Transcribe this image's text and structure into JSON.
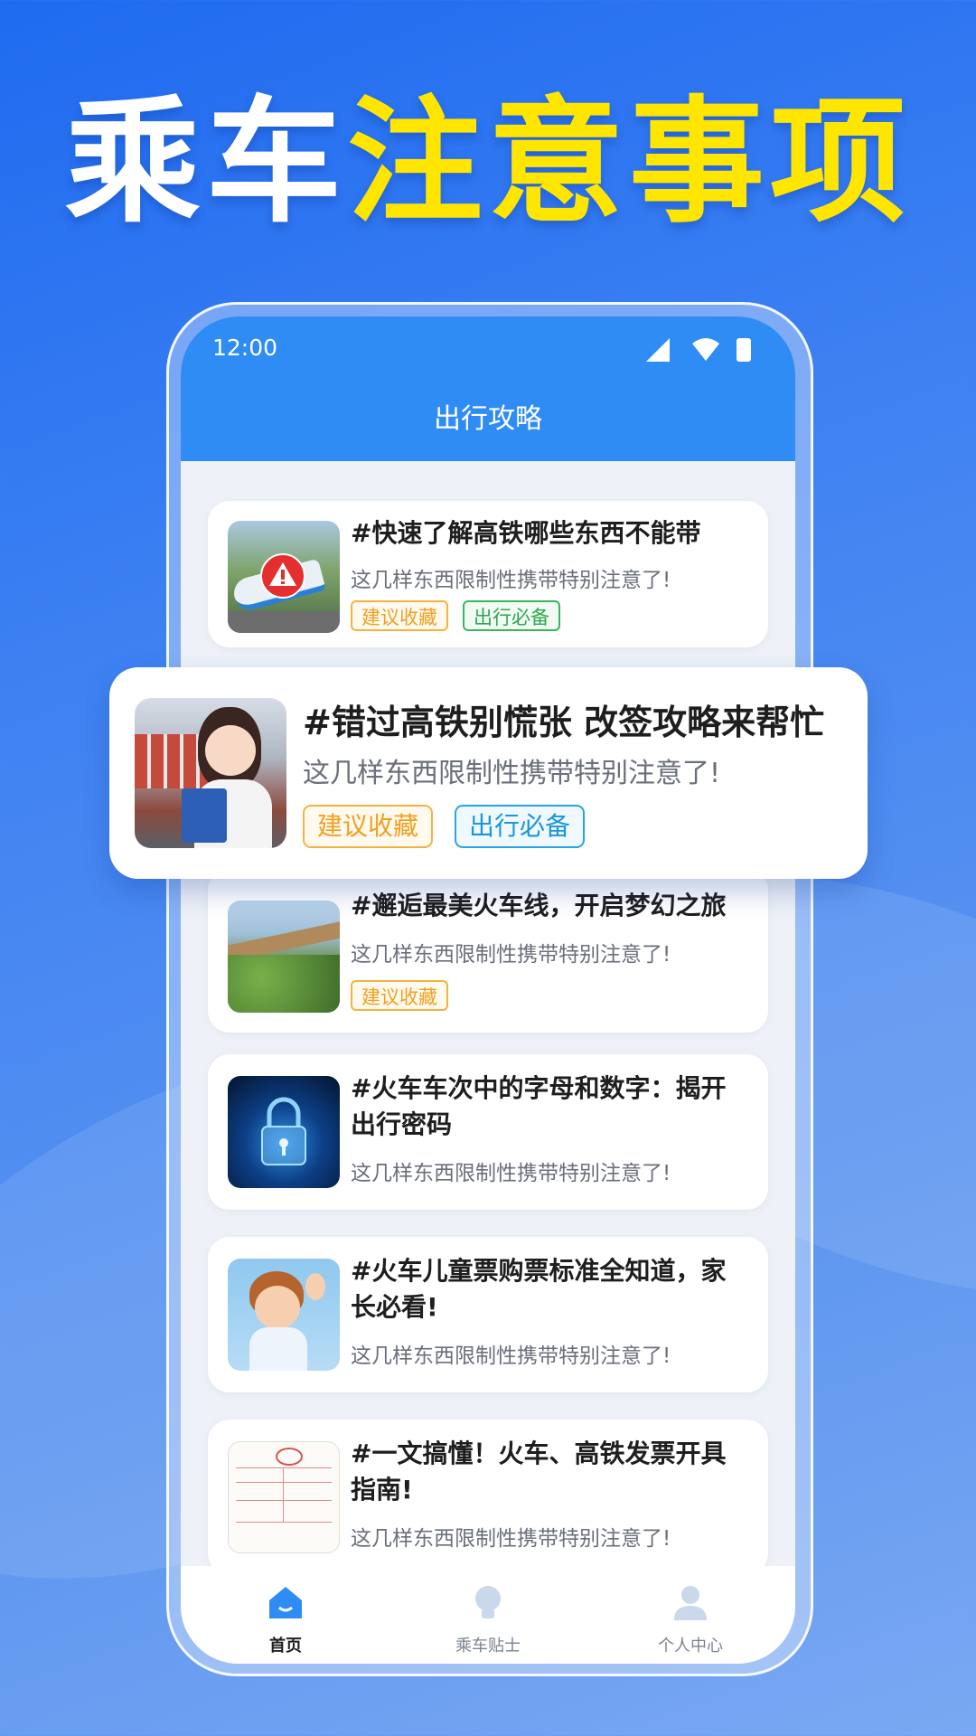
{
  "headline": {
    "part1": "乘车",
    "part2": "注意事项"
  },
  "status_bar": {
    "time": "12:00"
  },
  "app": {
    "title": "出行攻略"
  },
  "articles": [
    {
      "title": "#快速了解高铁哪些东西不能带",
      "desc": "这几样东西限制性携带特别注意了!",
      "tags": [
        "建议收藏",
        "出行必备"
      ]
    },
    {
      "title": "#邂逅最美火车线，开启梦幻之旅",
      "desc": "这几样东西限制性携带特别注意了!",
      "tags": [
        "建议收藏"
      ]
    },
    {
      "title": "#火车车次中的字母和数字：揭开出行密码",
      "desc": "这几样东西限制性携带特别注意了!",
      "tags": []
    },
    {
      "title": "#火车儿童票购票标准全知道，家长必看!",
      "desc": "这几样东西限制性携带特别注意了!",
      "tags": []
    },
    {
      "title": "#一文搞懂！火车、高铁发票开具指南!",
      "desc": "这几样东西限制性携带特别注意了!",
      "tags": []
    }
  ],
  "featured": {
    "title": "#错过高铁别慌张 改签攻略来帮忙",
    "desc": "这几样东西限制性携带特别注意了!",
    "tags": [
      "建议收藏",
      "出行必备"
    ]
  },
  "tab_bar": {
    "home": "首页",
    "tips": "乘车贴士",
    "profile": "个人中心"
  },
  "colors": {
    "accent": "#2f8cf5",
    "headline_yellow": "#ffe600",
    "tag_orange": "#f0a020",
    "tag_green": "#2ea64f",
    "tag_blue": "#1a95de"
  },
  "icons": {
    "home": "house-icon",
    "tips": "lightbulb-icon",
    "profile": "person-icon",
    "warning": "warning-icon"
  }
}
